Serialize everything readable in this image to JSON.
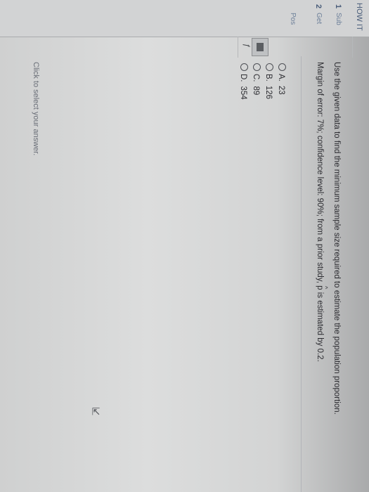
{
  "left_panel": {
    "header": "HOW IT",
    "items": [
      {
        "num": "1",
        "label": "Sub"
      },
      {
        "num": "2",
        "label": "Get"
      },
      {
        "num": "",
        "label": "Pos"
      }
    ]
  },
  "question": {
    "text": "Use the given data to find the minimum sample size required to estimate the population proportion.",
    "margin_prefix": "Margin of error: 7%; confidence level: 90%; from a prior study, ",
    "p_symbol": "p",
    "margin_suffix": " is estimated by 0.2."
  },
  "options": [
    {
      "letter": "A.",
      "value": "23"
    },
    {
      "letter": "B.",
      "value": "126"
    },
    {
      "letter": "C.",
      "value": "89"
    },
    {
      "letter": "D.",
      "value": "354"
    }
  ],
  "hint": "Click to select your answer.",
  "icons": {
    "radio": "radio-circle-icon",
    "tool": "calculator-icon",
    "cursor": "mouse-pointer-icon"
  }
}
